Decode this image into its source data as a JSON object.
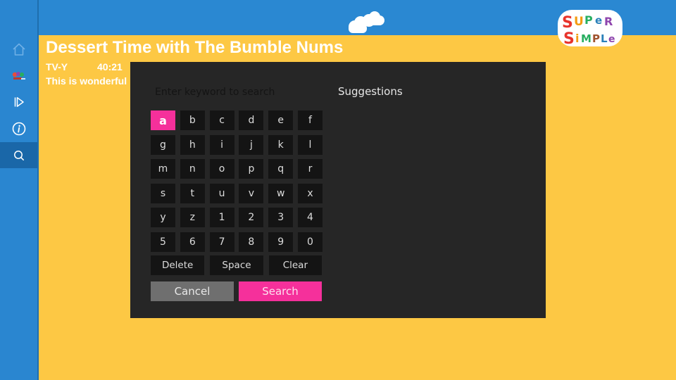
{
  "colors": {
    "header_blue": "#2a88d2",
    "background_yellow": "#fdc844",
    "sidebar_blue": "#2a86d0",
    "sidebar_selected": "#1a67a8",
    "panel": "#262626",
    "key": "#141414",
    "accent_pink": "#f5309b",
    "cancel_gray": "#6f6f6f"
  },
  "brand": {
    "logo_line1": "SUPER",
    "logo_line2": "SIMPLE"
  },
  "sidebar": {
    "items": [
      {
        "name": "home",
        "icon": "home-icon",
        "selected": false
      },
      {
        "name": "channel",
        "icon": "channel-logo-icon",
        "selected": false
      },
      {
        "name": "play",
        "icon": "play-icon",
        "selected": false
      },
      {
        "name": "info",
        "icon": "info-icon",
        "selected": false
      },
      {
        "name": "search",
        "icon": "search-icon",
        "selected": true
      }
    ]
  },
  "video": {
    "title": "Dessert Time with The Bumble Nums",
    "rating": "TV-Y",
    "duration": "40:21",
    "description": "This is wonderful "
  },
  "search": {
    "placeholder": "Enter keyword to search",
    "value": "",
    "suggestions_label": "Suggestions",
    "keys": [
      "a",
      "b",
      "c",
      "d",
      "e",
      "f",
      "g",
      "h",
      "i",
      "j",
      "k",
      "l",
      "m",
      "n",
      "o",
      "p",
      "q",
      "r",
      "s",
      "t",
      "u",
      "v",
      "w",
      "x",
      "y",
      "z",
      "1",
      "2",
      "3",
      "4",
      "5",
      "6",
      "7",
      "8",
      "9",
      "0"
    ],
    "focused_key": "a",
    "delete_label": "Delete",
    "space_label": "Space",
    "clear_label": "Clear",
    "cancel_label": "Cancel",
    "search_label": "Search"
  }
}
